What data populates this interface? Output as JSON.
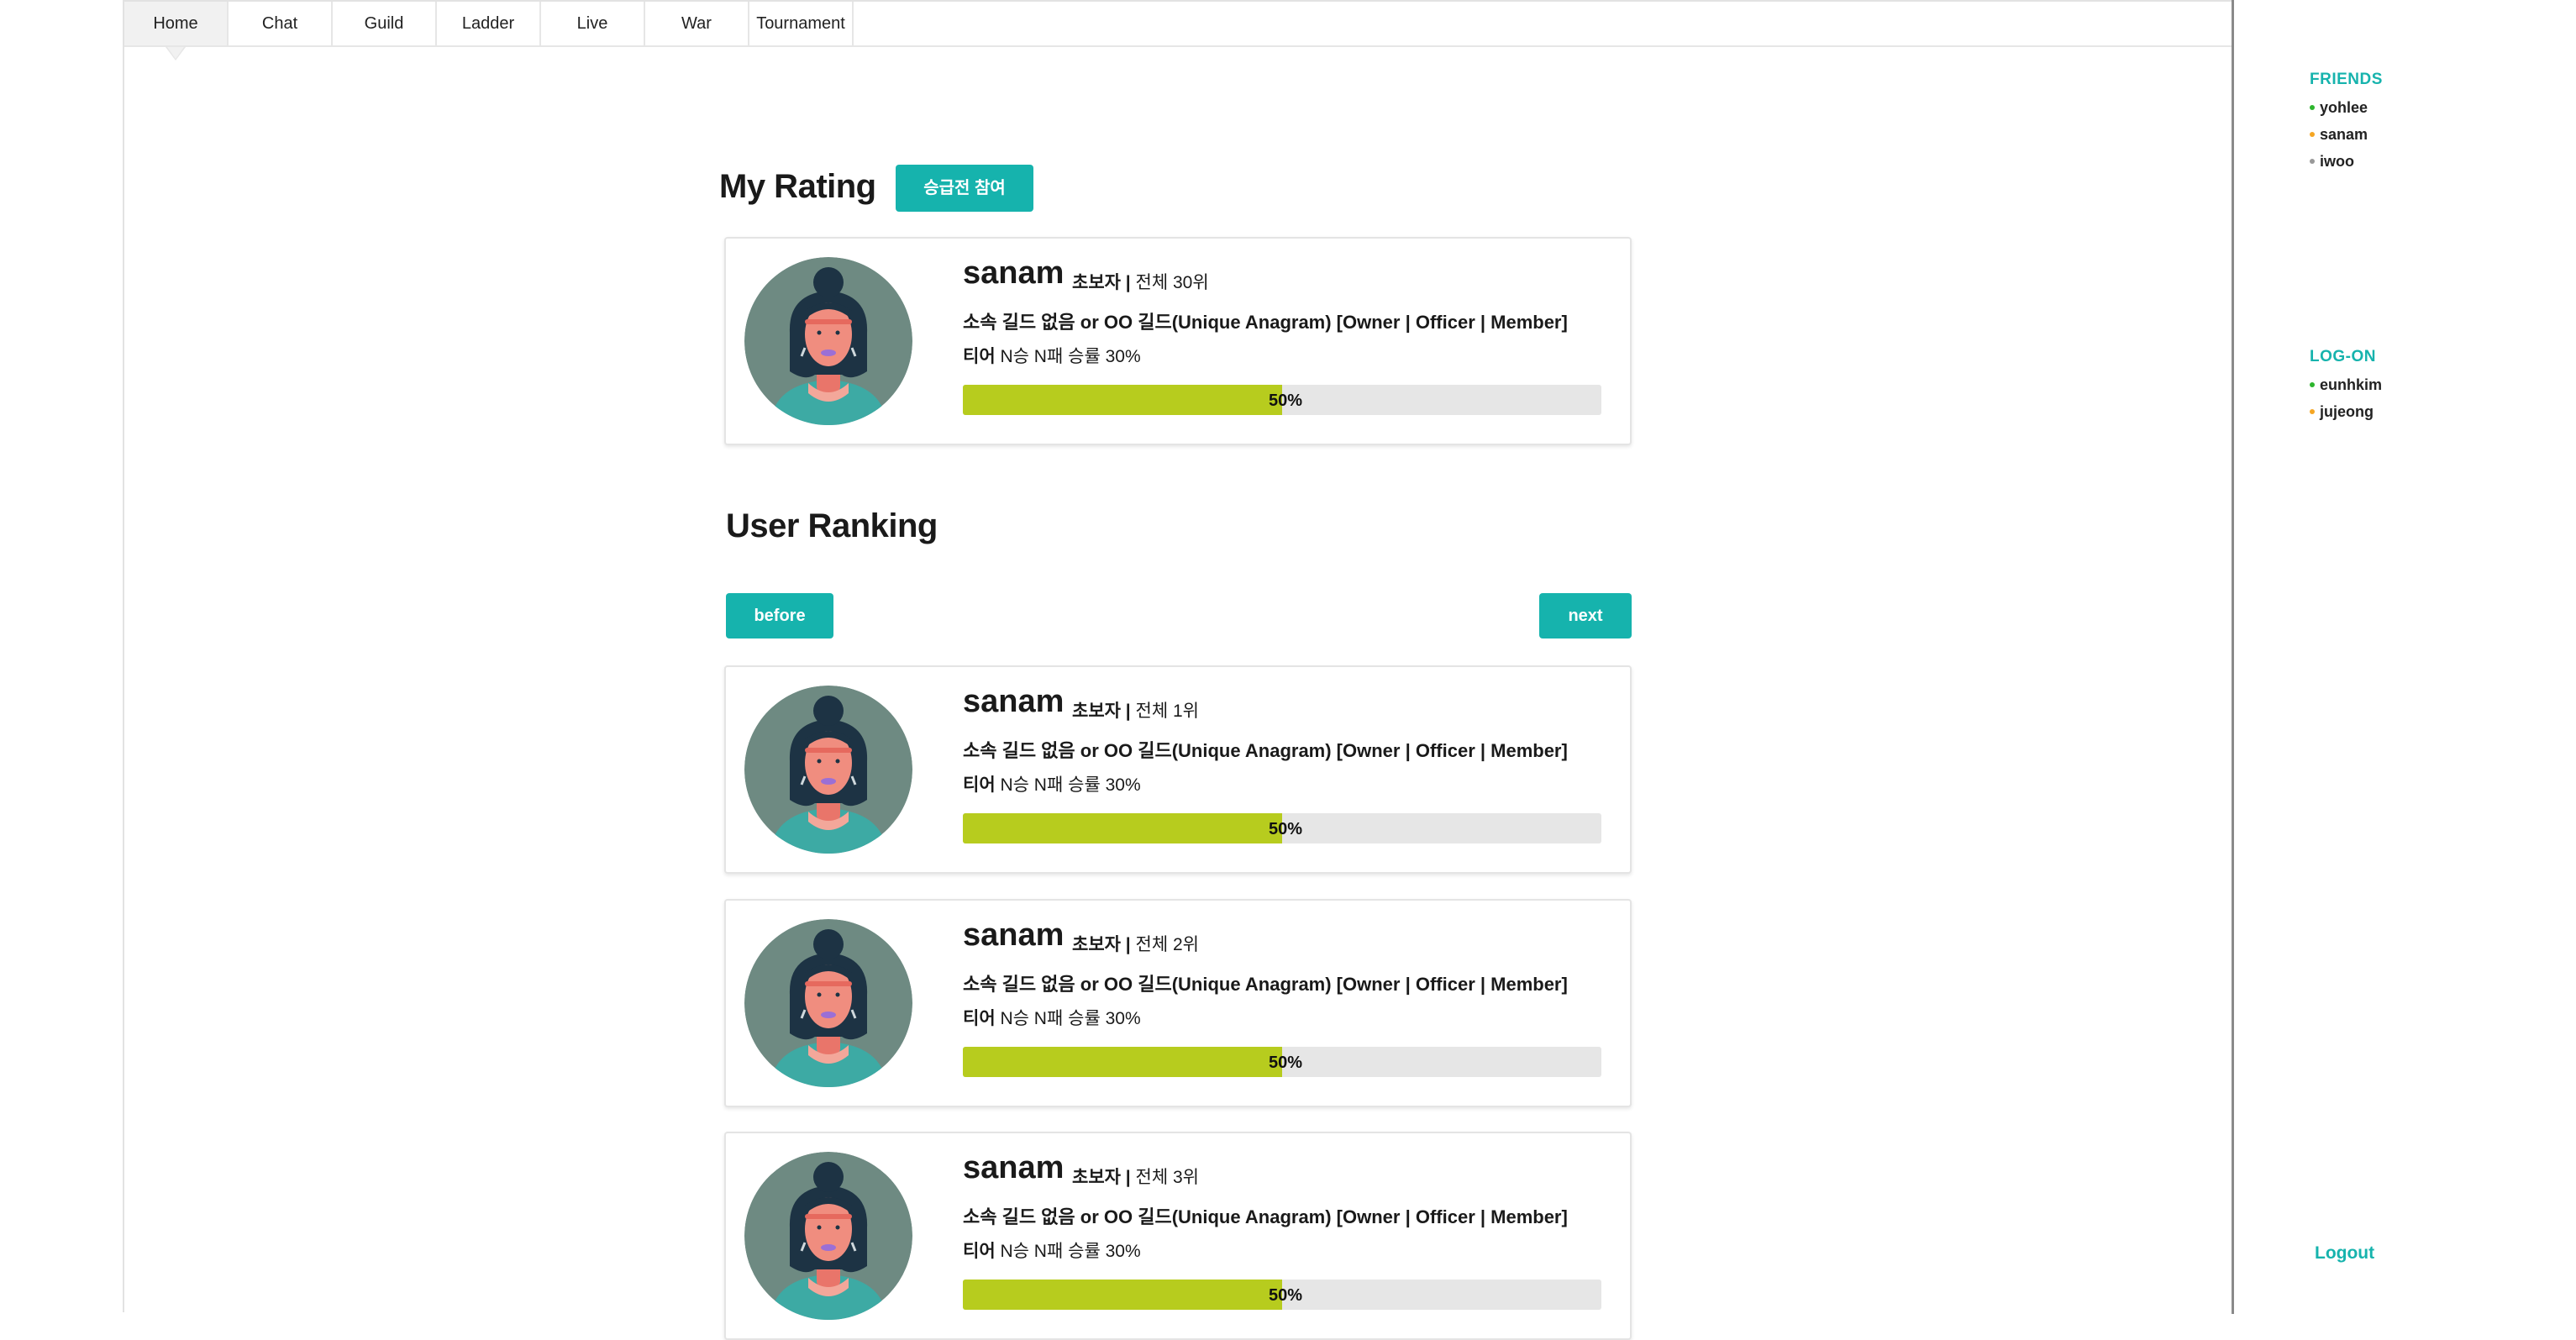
{
  "nav": {
    "tabs": [
      {
        "label": "Home",
        "active": true
      },
      {
        "label": "Chat"
      },
      {
        "label": "Guild"
      },
      {
        "label": "Ladder"
      },
      {
        "label": "Live"
      },
      {
        "label": "War"
      },
      {
        "label": "Tournament"
      }
    ]
  },
  "sidebar": {
    "friends_title": "FRIENDS",
    "friends": [
      {
        "name": "yohlee",
        "status_color": "#2db52d"
      },
      {
        "name": "sanam",
        "status_color": "#f5a623"
      },
      {
        "name": "iwoo",
        "status_color": "#999999"
      }
    ],
    "logon_title": "LOG-ON",
    "logon": [
      {
        "name": "eunhkim",
        "status_color": "#2db52d"
      },
      {
        "name": "jujeong",
        "status_color": "#f5a623"
      }
    ],
    "logout_label": "Logout"
  },
  "my_rating": {
    "title": "My Rating",
    "promo_button": "승급전 참여",
    "card": {
      "name": "sanam",
      "level": "초보자",
      "separator": " | ",
      "rank": "전체 30위",
      "guild": "소속 길드 없음 or OO 길드(Unique Anagram) [Owner | Officer | Member]",
      "tier_label": "티어",
      "record": "N승 N패 승률 30%",
      "progress": 50,
      "progress_label": "50%"
    }
  },
  "user_ranking": {
    "title": "User Ranking",
    "before_label": "before",
    "next_label": "next",
    "cards": [
      {
        "name": "sanam",
        "level": "초보자",
        "separator": " | ",
        "rank": "전체 1위",
        "guild": "소속 길드 없음 or OO 길드(Unique Anagram) [Owner | Officer | Member]",
        "tier_label": "티어",
        "record": "N승 N패 승률 30%",
        "progress": 50,
        "progress_label": "50%"
      },
      {
        "name": "sanam",
        "level": "초보자",
        "separator": " | ",
        "rank": "전체 2위",
        "guild": "소속 길드 없음 or OO 길드(Unique Anagram) [Owner | Officer | Member]",
        "tier_label": "티어",
        "record": "N승 N패 승률 30%",
        "progress": 50,
        "progress_label": "50%"
      },
      {
        "name": "sanam",
        "level": "초보자",
        "separator": " | ",
        "rank": "전체 3위",
        "guild": "소속 길드 없음 or OO 길드(Unique Anagram) [Owner | Officer | Member]",
        "tier_label": "티어",
        "record": "N승 N패 승률 30%",
        "progress": 50,
        "progress_label": "50%"
      }
    ]
  },
  "colors": {
    "accent": "#16b3ad",
    "progress_fill": "#b7cc1e",
    "progress_track": "#e6e6e6",
    "avatar_bg": "#6e8a82"
  }
}
